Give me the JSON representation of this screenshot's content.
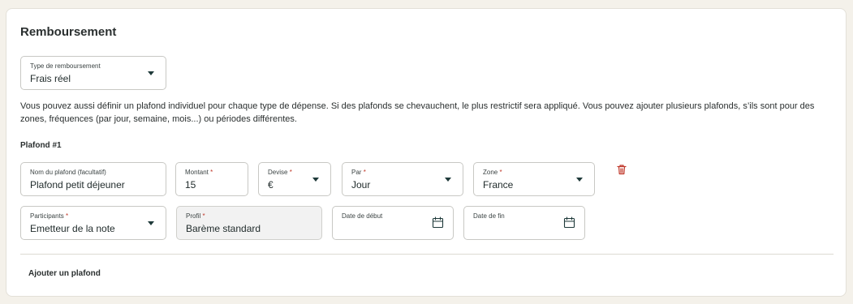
{
  "section_title": "Remboursement",
  "reimbursement_type": {
    "label": "Type de remboursement",
    "value": "Frais réel"
  },
  "description": "Vous pouvez aussi définir un plafond individuel pour chaque type de dépense. Si des plafonds se chevauchent, le plus restrictif sera appliqué. Vous pouvez ajouter plusieurs plafonds, s’ils sont pour des zones, fréquences (par jour, semaine, mois...) ou périodes différentes.",
  "ceiling": {
    "heading": "Plafond #1",
    "name": {
      "label": "Nom du plafond (facultatif)",
      "value": "Plafond petit déjeuner"
    },
    "amount": {
      "label": "Montant",
      "value": "15"
    },
    "currency": {
      "label": "Devise",
      "value": "€"
    },
    "per": {
      "label": "Par",
      "value": "Jour"
    },
    "zone": {
      "label": "Zone",
      "value": "France"
    },
    "participants": {
      "label": "Participants",
      "value": "Emetteur de la note"
    },
    "profile": {
      "label": "Profil",
      "value": "Barème standard"
    },
    "start_date": {
      "label": "Date de début",
      "value": ""
    },
    "end_date": {
      "label": "Date de fin",
      "value": ""
    },
    "required_mark": "*"
  },
  "add_ceiling_label": "Ajouter un plafond",
  "icons": {
    "dropdown": "chevron-down-icon",
    "calendar": "calendar-icon",
    "delete": "trash-icon"
  },
  "colors": {
    "background": "#f4f1ea",
    "delete_icon": "#c0392b",
    "required_mark": "#c0392b",
    "disabled_field": "#f2f2f2"
  }
}
